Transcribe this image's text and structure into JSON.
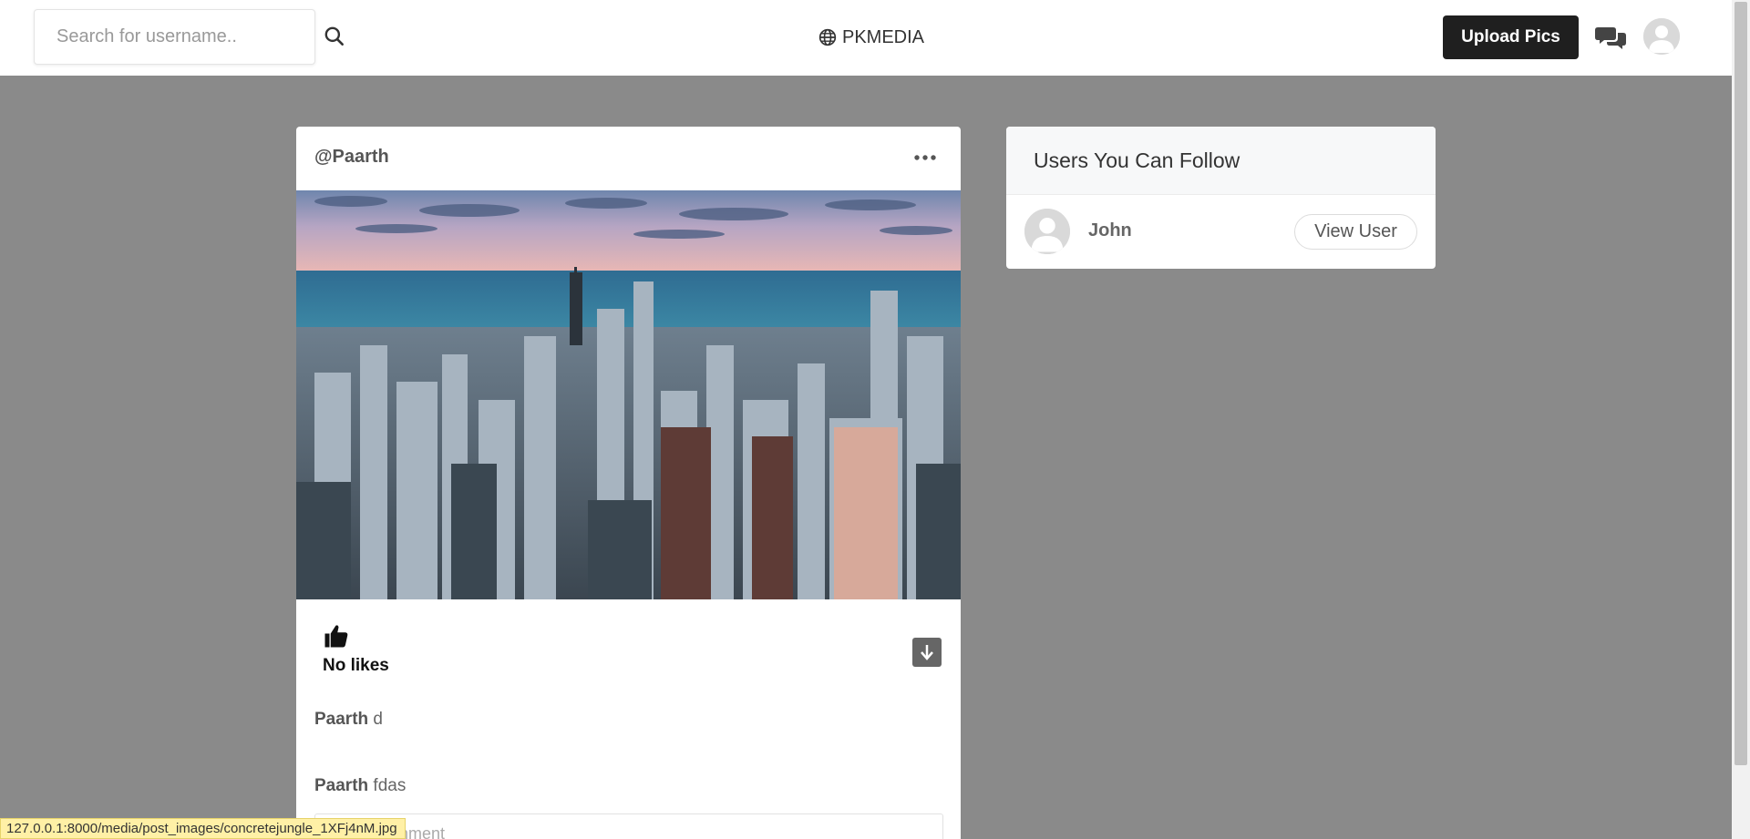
{
  "header": {
    "search_placeholder": "Search for username..",
    "brand_name": "PKMEDIA",
    "upload_label": "Upload Pics"
  },
  "post": {
    "author": "@Paarth",
    "likes_label": "No likes",
    "comments": [
      {
        "user": "Paarth",
        "text": "d"
      },
      {
        "user": "Paarth",
        "text": "fdas"
      }
    ],
    "comment_placeholder": "Add a comment"
  },
  "suggestions": {
    "title": "Users You Can Follow",
    "users": [
      {
        "name": "John",
        "action_label": "View User"
      }
    ]
  },
  "status_bar": {
    "url": "127.0.0.1:8000/media/post_images/concretejungle_1XFj4nM.jpg"
  },
  "colors": {
    "page_background": "#8a8a8a",
    "upload_button": "#1f1f1f",
    "status_tooltip": "#fff0a6"
  },
  "icons": {
    "search": "search-icon",
    "brand": "globe-icon",
    "chat": "comments-icon",
    "more": "ellipsis-icon",
    "like": "thumbs-up-icon",
    "download": "download-icon",
    "avatar": "user-avatar-icon"
  }
}
